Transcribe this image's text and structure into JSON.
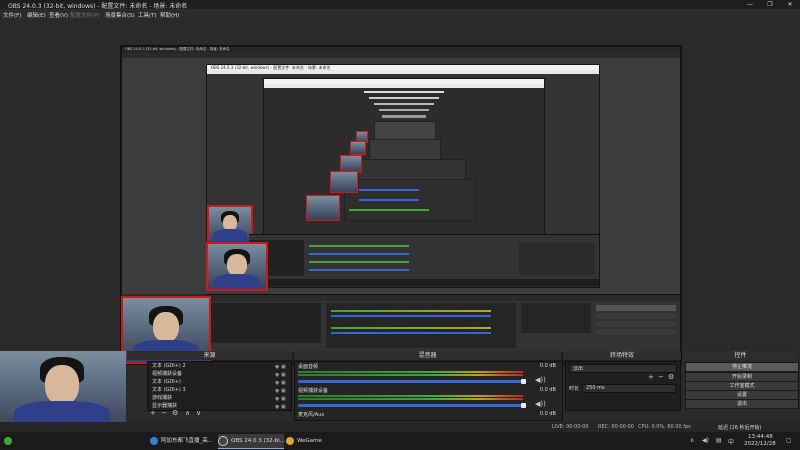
{
  "window": {
    "title": "OBS 24.0.3 (32-bit, windows) - 配置文件: 未命名 - 场景: 未命名",
    "controls": [
      "—",
      "❐",
      "✕"
    ]
  },
  "menu": [
    "文件(F)",
    "编辑(E)",
    "查看(V)",
    "配置文件(P)",
    "场景集合(S)",
    "工具(T)",
    "帮助(H)"
  ],
  "docks": {
    "sources_title": "来源",
    "mixer_title": "混音器",
    "transitions_title": "转场特效",
    "controls_title": "控件"
  },
  "sources": [
    "文本 (GDI+) 2",
    "视频捕获设备",
    "文本 (GDI+)",
    "文本 (GDI+) 3",
    "游戏捕获",
    "显示器捕获"
  ],
  "mixer": [
    {
      "name": "桌面音频",
      "db": "0.0 dB"
    },
    {
      "name": "视频捕获设备",
      "db": "0.0 dB"
    },
    {
      "name": "麦克风/Aux",
      "db": "0.0 dB"
    }
  ],
  "transitions": {
    "type": "淡出",
    "duration_label": "时长",
    "duration_value": "250 ms"
  },
  "controls": [
    {
      "label": "停止推流",
      "active": true
    },
    {
      "label": "开始录制",
      "active": false
    },
    {
      "label": "工作室模式",
      "active": false
    },
    {
      "label": "设置",
      "active": false
    },
    {
      "label": "退出",
      "active": false
    }
  ],
  "status": {
    "live": "LIVE: 00:00:00",
    "rec": "REC: 00:00:00",
    "cpu": "CPU: 0.0%, 60.00 fps",
    "delay": "延迟 (16 秒后开始)"
  },
  "taskbar": {
    "items": [
      {
        "label": "阿加东都飞直播_高...",
        "active": false
      },
      {
        "label": "OBS 24.0.3 (32-bi...",
        "active": true
      },
      {
        "label": "WeGame",
        "active": false
      }
    ],
    "time": "13:44:48",
    "date": "2022/12/28"
  },
  "nested": {
    "title_small": "OBS 24.0.3 (32-bit, windows) - 配置文件: 未命名 - 场景: 未命名"
  },
  "colors": {
    "accent_border": "#d01818",
    "volume_blue": "#3465d9"
  }
}
